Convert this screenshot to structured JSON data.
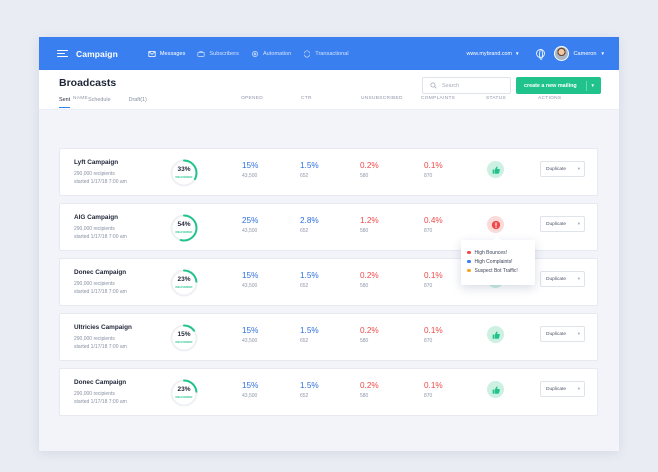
{
  "topbar": {
    "brand": "Campaign",
    "nav": [
      {
        "label": "Messages",
        "icon": "envelope-icon",
        "active": true
      },
      {
        "label": "Subscribers",
        "icon": "users-icon",
        "active": false
      },
      {
        "label": "Automation",
        "icon": "gear-icon",
        "active": false
      },
      {
        "label": "Transactional",
        "icon": "transfer-icon",
        "active": false
      }
    ],
    "domain": "www.mybrand.com",
    "user": "Cameron"
  },
  "header": {
    "title": "Broadcasts",
    "tabs": [
      "Sent",
      "Schedule",
      "Draft(1)"
    ],
    "search_placeholder": "Search",
    "create_button": "create a new mailing"
  },
  "columns": [
    "NAME",
    "OPENED",
    "CTR",
    "UNSUBSCRIBED",
    "COMPLAINTS",
    "STATUS",
    "ACTIONS"
  ],
  "rows": [
    {
      "name": "Lyft Campaign",
      "recipients": "290,000 recipients",
      "started": "started 1/17/18 7:00 am",
      "delivered_pct": "33%",
      "delivered_fraction": 0.33,
      "delivered_label": "DELIVERED",
      "opened": "15%",
      "opened_count": "43,500",
      "ctr": "1.5%",
      "ctr_count": "652",
      "unsub": "0.2%",
      "unsub_count": "580",
      "complaints": "0.1%",
      "complaints_count": "870",
      "status": "ok",
      "action": "Duplicate"
    },
    {
      "name": "AIG Campaign",
      "recipients": "290,000 recipients",
      "started": "started 1/17/18 7:00 am",
      "delivered_pct": "54%",
      "delivered_fraction": 0.54,
      "delivered_label": "DELIVERED",
      "opened": "25%",
      "opened_count": "43,500",
      "ctr": "2.8%",
      "ctr_count": "652",
      "unsub": "1.2%",
      "unsub_count": "580",
      "complaints": "0.4%",
      "complaints_count": "870",
      "status": "alert",
      "action": "Duplicate"
    },
    {
      "name": "Donec Campaign",
      "recipients": "290,000 recipients",
      "started": "started 1/17/18 7:00 am",
      "delivered_pct": "23%",
      "delivered_fraction": 0.23,
      "delivered_label": "DELIVERED",
      "opened": "15%",
      "opened_count": "43,500",
      "ctr": "1.5%",
      "ctr_count": "652",
      "unsub": "0.2%",
      "unsub_count": "580",
      "complaints": "0.1%",
      "complaints_count": "870",
      "status": "ok",
      "action": "Duplicate"
    },
    {
      "name": "Ultricies Campaign",
      "recipients": "290,000 recipients",
      "started": "started 1/17/18 7:00 am",
      "delivered_pct": "15%",
      "delivered_fraction": 0.15,
      "delivered_label": "DELIVERED",
      "opened": "15%",
      "opened_count": "43,500",
      "ctr": "1.5%",
      "ctr_count": "652",
      "unsub": "0.2%",
      "unsub_count": "580",
      "complaints": "0.1%",
      "complaints_count": "870",
      "status": "ok",
      "action": "Duplicate"
    },
    {
      "name": "Donec Campaign",
      "recipients": "290,000 recipients",
      "started": "started 1/17/18 7:00 am",
      "delivered_pct": "23%",
      "delivered_fraction": 0.23,
      "delivered_label": "DELIVERED",
      "opened": "15%",
      "opened_count": "43,500",
      "ctr": "1.5%",
      "ctr_count": "652",
      "unsub": "0.2%",
      "unsub_count": "580",
      "complaints": "0.1%",
      "complaints_count": "870",
      "status": "ok",
      "action": "Duplicate"
    }
  ],
  "tooltip": [
    {
      "text": "High Bounces!",
      "color": "#ee4a4a"
    },
    {
      "text": "High Complaints!",
      "color": "#3a7ff0"
    },
    {
      "text": "Suspect Bot Traffic!",
      "color": "#f5a623"
    }
  ],
  "colors": {
    "primary": "#3a7ff0",
    "success": "#21c38c",
    "danger": "#ee4a4a"
  }
}
